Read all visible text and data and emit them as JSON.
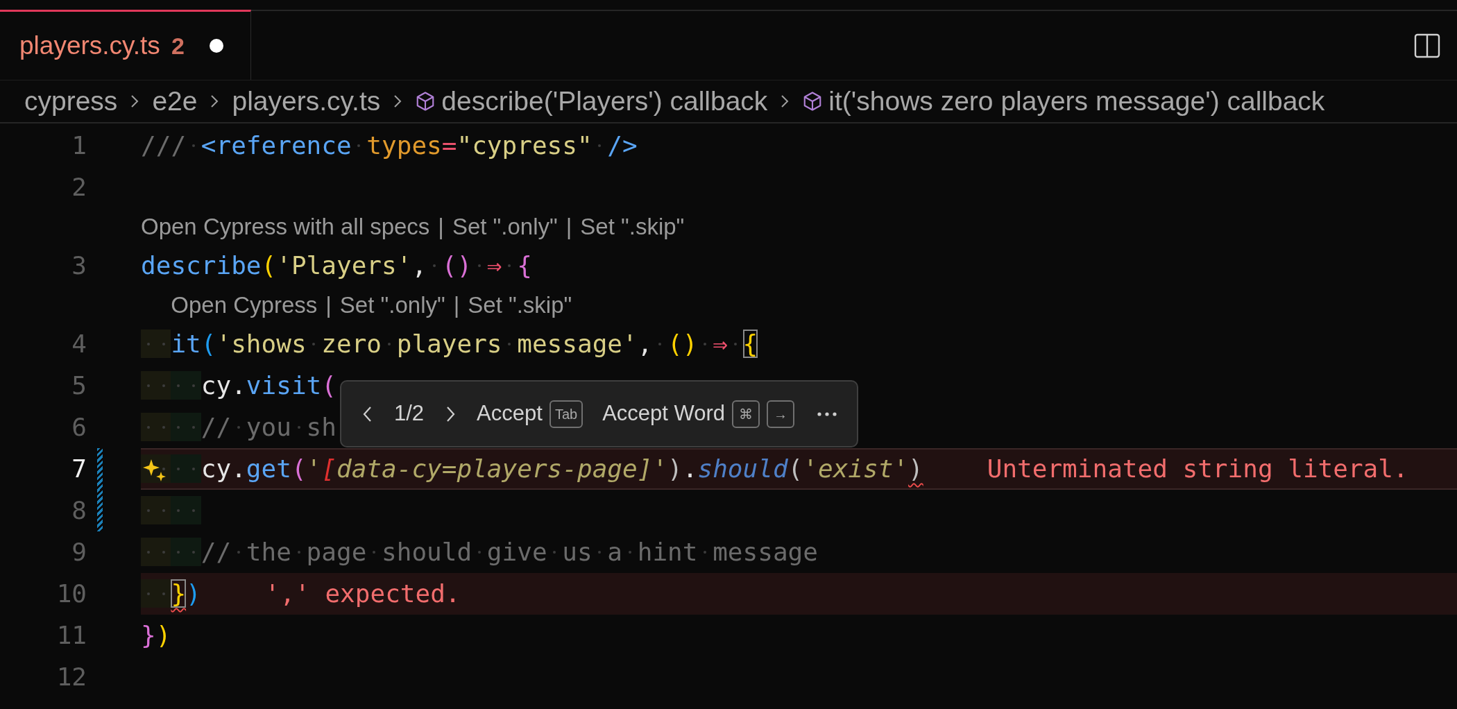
{
  "tabs": [
    {
      "label": "players.cy.ts",
      "problems": "2",
      "dirty": true,
      "selected": true
    }
  ],
  "breadcrumbs": [
    {
      "label": "cypress",
      "kind": "folder"
    },
    {
      "label": "e2e",
      "kind": "folder"
    },
    {
      "label": "players.cy.ts",
      "kind": "file"
    },
    {
      "label": "describe('Players') callback",
      "kind": "symbol"
    },
    {
      "label": "it('shows zero players message') callback",
      "kind": "symbol"
    }
  ],
  "editor": {
    "lines": [
      {
        "kind": "code",
        "number": "1",
        "tokens": [
          {
            "kind": "comment",
            "text": "///",
            "space_after": true
          },
          {
            "kind": "tag",
            "text": "<reference",
            "space_after": true
          },
          {
            "kind": "attr",
            "text": "types"
          },
          {
            "kind": "op",
            "text": "="
          },
          {
            "kind": "string",
            "text": "\"cypress\"",
            "space_after": true
          },
          {
            "kind": "tag",
            "text": "/>"
          }
        ]
      },
      {
        "kind": "code",
        "number": "2"
      },
      {
        "kind": "lens",
        "nested": false,
        "links": [
          "Open Cypress with all specs",
          "Set \".only\"",
          "Set \".skip\""
        ],
        "separator": "|"
      },
      {
        "kind": "code",
        "number": "3",
        "tokens": [
          {
            "kind": "func",
            "text": "describe"
          },
          {
            "kind": "bracket1",
            "text": "("
          },
          {
            "kind": "string",
            "text": "'Players'"
          },
          {
            "kind": "plain",
            "text": ",",
            "space_after": true
          },
          {
            "kind": "bracket2",
            "text": "()",
            "space_after": true
          },
          {
            "kind": "arrow",
            "text": "⇒",
            "space_after": true
          },
          {
            "kind": "bracket2",
            "text": "{"
          }
        ]
      },
      {
        "kind": "lens",
        "nested": true,
        "links": [
          "Open Cypress",
          "Set \".only\"",
          "Set \".skip\""
        ],
        "separator": "|"
      },
      {
        "kind": "code",
        "number": "4",
        "tokens": [
          {
            "kind": "indent_outer"
          },
          {
            "kind": "func",
            "text": "it"
          },
          {
            "kind": "bracket3",
            "text": "("
          },
          {
            "kind": "string",
            "text": "'shows zero players message'"
          },
          {
            "kind": "plain",
            "text": ",",
            "space_after": true
          },
          {
            "kind": "bracket1",
            "text": "()",
            "space_after": true
          },
          {
            "kind": "arrow",
            "text": "⇒",
            "space_after": true
          },
          {
            "kind": "bracket1",
            "text": "{",
            "matched": true
          }
        ]
      },
      {
        "kind": "code",
        "number": "5",
        "tokens": [
          {
            "kind": "indent_outer"
          },
          {
            "kind": "indent_inner"
          },
          {
            "kind": "plain",
            "text": "cy."
          },
          {
            "kind": "func",
            "text": "visit"
          },
          {
            "kind": "bracket2",
            "text": "("
          }
        ]
      },
      {
        "kind": "code",
        "number": "6",
        "tokens": [
          {
            "kind": "indent_outer"
          },
          {
            "kind": "indent_inner"
          },
          {
            "kind": "comment",
            "text": "// you sh"
          }
        ]
      },
      {
        "kind": "code",
        "number": "7",
        "active": true,
        "error_row": true,
        "changed": true,
        "suggestion": true,
        "message": "Unterminated string literal.",
        "tokens": [
          {
            "kind": "indent_outer"
          },
          {
            "kind": "indent_inner"
          },
          {
            "kind": "plain",
            "text": "cy."
          },
          {
            "kind": "func",
            "text": "get"
          },
          {
            "kind": "bracket2",
            "text": "("
          },
          {
            "kind": "istring",
            "text": "'"
          },
          {
            "kind": "ired",
            "text": "["
          },
          {
            "kind": "istring",
            "text": "data-cy=players-page]'"
          },
          {
            "kind": "punct",
            "text": ")"
          },
          {
            "kind": "plain",
            "text": "."
          },
          {
            "kind": "imethod",
            "text": "should"
          },
          {
            "kind": "punct",
            "text": "("
          },
          {
            "kind": "istring",
            "text": "'exist'"
          },
          {
            "kind": "punct",
            "text": ")",
            "error": true
          }
        ]
      },
      {
        "kind": "code",
        "number": "8",
        "changed": true,
        "tokens": [
          {
            "kind": "indent_outer"
          },
          {
            "kind": "indent_inner"
          }
        ]
      },
      {
        "kind": "code",
        "number": "9",
        "tokens": [
          {
            "kind": "indent_outer"
          },
          {
            "kind": "indent_inner"
          },
          {
            "kind": "comment",
            "text": "// the page should give us a hint message"
          }
        ]
      },
      {
        "kind": "code",
        "number": "10",
        "error_row": true,
        "message": "',' expected.",
        "tokens": [
          {
            "kind": "indent_outer"
          },
          {
            "kind": "bracket1",
            "text": "}",
            "matched": true,
            "error": true
          },
          {
            "kind": "bracket3",
            "text": ")"
          }
        ]
      },
      {
        "kind": "code",
        "number": "11",
        "tokens": [
          {
            "kind": "bracket2",
            "text": "}"
          },
          {
            "kind": "bracket1",
            "text": ")"
          }
        ]
      },
      {
        "kind": "code",
        "number": "12"
      }
    ]
  },
  "suggestion_widget": {
    "counter": "1/2",
    "actions": [
      {
        "label": "Accept",
        "keys": [
          "Tab"
        ]
      },
      {
        "label": "Accept Word",
        "keys": [
          "⌘",
          "→"
        ]
      }
    ]
  }
}
